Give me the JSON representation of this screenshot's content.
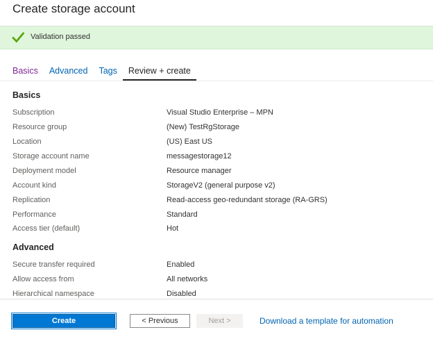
{
  "header": {
    "title": "Create storage account"
  },
  "validation": {
    "text": "Validation passed",
    "icon": "check-icon",
    "color": "#57a300"
  },
  "tabs": [
    {
      "label": "Basics",
      "state": "visited"
    },
    {
      "label": "Advanced",
      "state": "default"
    },
    {
      "label": "Tags",
      "state": "default"
    },
    {
      "label": "Review + create",
      "state": "active"
    }
  ],
  "sections": {
    "basics": {
      "heading": "Basics",
      "rows": [
        {
          "label": "Subscription",
          "value": "Visual Studio Enterprise – MPN"
        },
        {
          "label": "Resource group",
          "value": "(New) TestRgStorage"
        },
        {
          "label": "Location",
          "value": "(US) East US"
        },
        {
          "label": "Storage account name",
          "value": "messagestorage12"
        },
        {
          "label": "Deployment model",
          "value": "Resource manager"
        },
        {
          "label": "Account kind",
          "value": "StorageV2 (general purpose v2)"
        },
        {
          "label": "Replication",
          "value": "Read-access geo-redundant storage (RA-GRS)"
        },
        {
          "label": "Performance",
          "value": "Standard"
        },
        {
          "label": "Access tier (default)",
          "value": "Hot"
        }
      ]
    },
    "advanced": {
      "heading": "Advanced",
      "rows": [
        {
          "label": "Secure transfer required",
          "value": "Enabled"
        },
        {
          "label": "Allow access from",
          "value": "All networks"
        },
        {
          "label": "Hierarchical namespace",
          "value": "Disabled"
        }
      ]
    }
  },
  "footer": {
    "create_label": "Create",
    "previous_label": "< Previous",
    "next_label": "Next >",
    "download_link": "Download a template for automation"
  },
  "colors": {
    "accent": "#0078d4",
    "link": "#0063b1",
    "visited_link": "#7f2894",
    "success_bg": "#dff6dd"
  }
}
